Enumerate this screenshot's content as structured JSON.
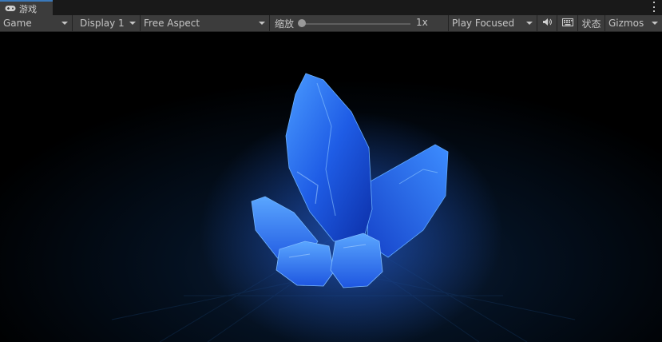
{
  "tab": {
    "title": "游戏",
    "icon": "gamepad-icon"
  },
  "toolbar": {
    "view_mode": "Game",
    "display": "Display 1",
    "aspect": "Free Aspect",
    "scale_label": "缩放",
    "scale_value": "1x",
    "play_mode": "Play Focused",
    "stats_label": "状态",
    "gizmos_label": "Gizmos"
  },
  "icons": {
    "audio": "speaker-icon",
    "keyboard": "keyboard-icon",
    "menu": "more-vertical-icon"
  },
  "scene": {
    "object": "blue crystal cluster",
    "background": "#000000",
    "glow_color": "#2a7bff"
  }
}
